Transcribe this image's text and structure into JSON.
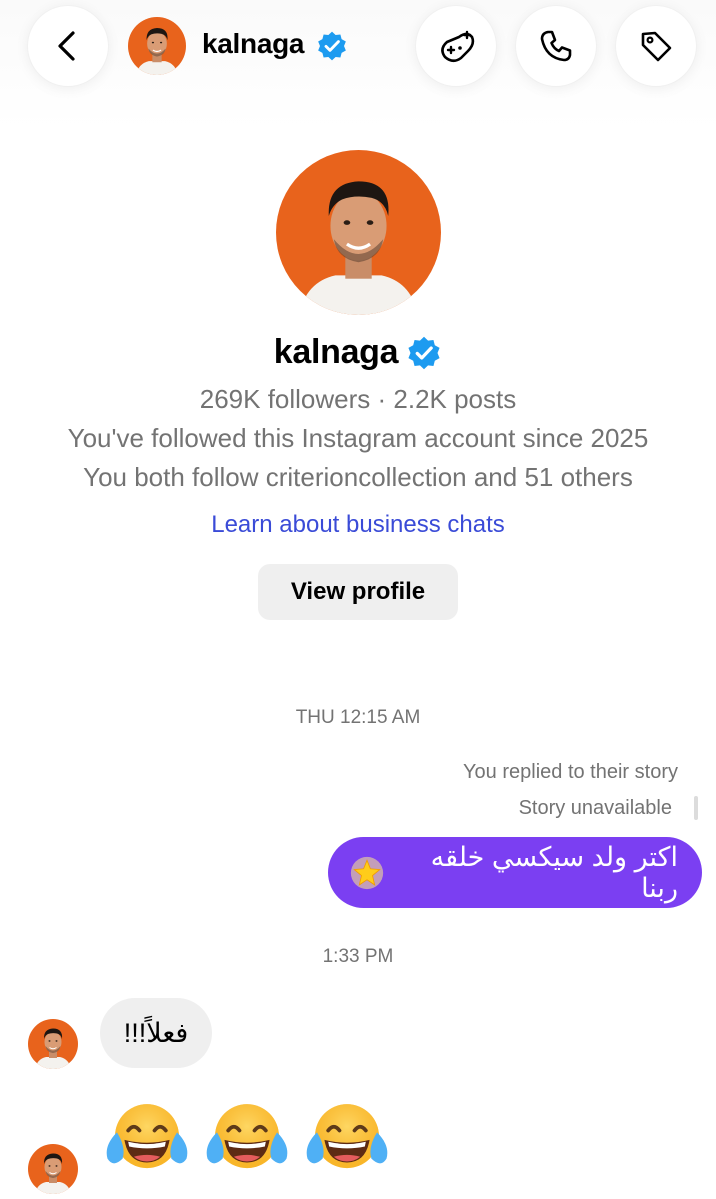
{
  "header": {
    "username": "kalnaga",
    "icons": {
      "back": "chevron-left-icon",
      "game": "game-controller-add-icon",
      "call": "phone-icon",
      "tag": "tag-icon",
      "verified": "verified-badge-icon"
    }
  },
  "profile": {
    "name": "kalnaga",
    "stats": "269K followers · 2.2K posts",
    "followed_since": "You've followed this Instagram account since 2025",
    "mutuals": "You both follow criterioncollection and 51 others",
    "learn_link": "Learn about business chats",
    "view_profile_label": "View profile"
  },
  "chat": {
    "timestamp_1": "THU 12:15 AM",
    "reply_note": "You replied to their story",
    "story_status": "Story unavailable",
    "outgoing_message": "اكتر ولد سيكسي خلقه ربنا",
    "outgoing_emoji": "glowing-star-emoji",
    "timestamp_2": "1:33 PM",
    "incoming_message": "فعلاً!!!",
    "incoming_emojis": [
      "face-with-tears-of-joy",
      "face-with-tears-of-joy",
      "face-with-tears-of-joy"
    ]
  },
  "colors": {
    "accent_bubble": "#7b3ff2",
    "link": "#3a4bd7",
    "verified": "#1d9bf0",
    "avatar_bg": "#e8631c",
    "secondary_text": "#737373",
    "incoming_bubble": "#efefef"
  }
}
